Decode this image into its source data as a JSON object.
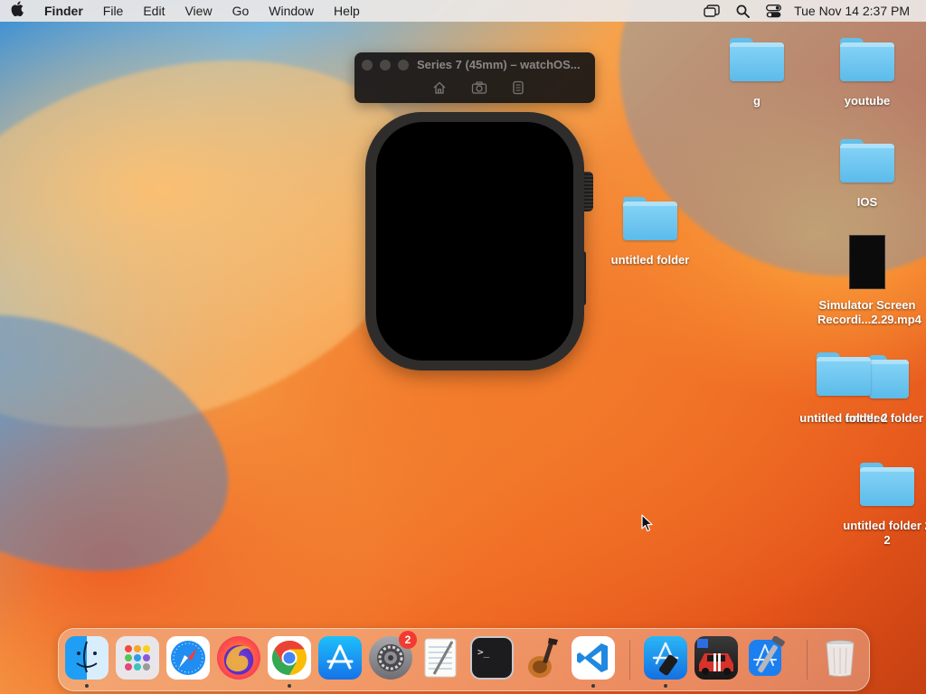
{
  "menubar": {
    "apple": "",
    "app_name": "Finder",
    "menus": [
      "File",
      "Edit",
      "View",
      "Go",
      "Window",
      "Help"
    ],
    "status_icons": [
      "window-switcher-icon",
      "spotlight-search-icon",
      "control-center-icon"
    ],
    "clock": "Tue Nov 14  2:37 PM"
  },
  "simulator": {
    "title": "Series 7 (45mm) – watchOS...",
    "tools": [
      "home-icon",
      "screenshot-icon",
      "rotate-icon"
    ]
  },
  "desktop": {
    "items": [
      {
        "label": "g",
        "kind": "folder"
      },
      {
        "label": "youtube",
        "kind": "folder"
      },
      {
        "label": "IOS",
        "kind": "folder"
      },
      {
        "label": "untitled folder",
        "kind": "folder"
      },
      {
        "label_line1": "Simulator Screen",
        "label_line2": "Recordi...2.29.mp4",
        "kind": "video"
      },
      {
        "label": "untitled folder 2",
        "kind": "folder"
      },
      {
        "label": "untitled folder 2",
        "kind": "folder"
      },
      {
        "label_line1": "untitled folder 2",
        "label_line2": "2",
        "kind": "folder"
      }
    ]
  },
  "dock": {
    "apps": [
      "Finder",
      "Launchpad",
      "Safari",
      "Firefox",
      "Google Chrome",
      "App Store",
      "System Settings",
      "TextEdit",
      "Terminal",
      "Instruments",
      "Visual Studio Code",
      "Simulator",
      "Need for Speed",
      "Xcode",
      "Trash"
    ],
    "settings_badge": "2"
  },
  "colors": {
    "folder_blue": "#6fc8f2",
    "menubar_bg": "#ece8e6",
    "badge_red": "#f23b30"
  }
}
